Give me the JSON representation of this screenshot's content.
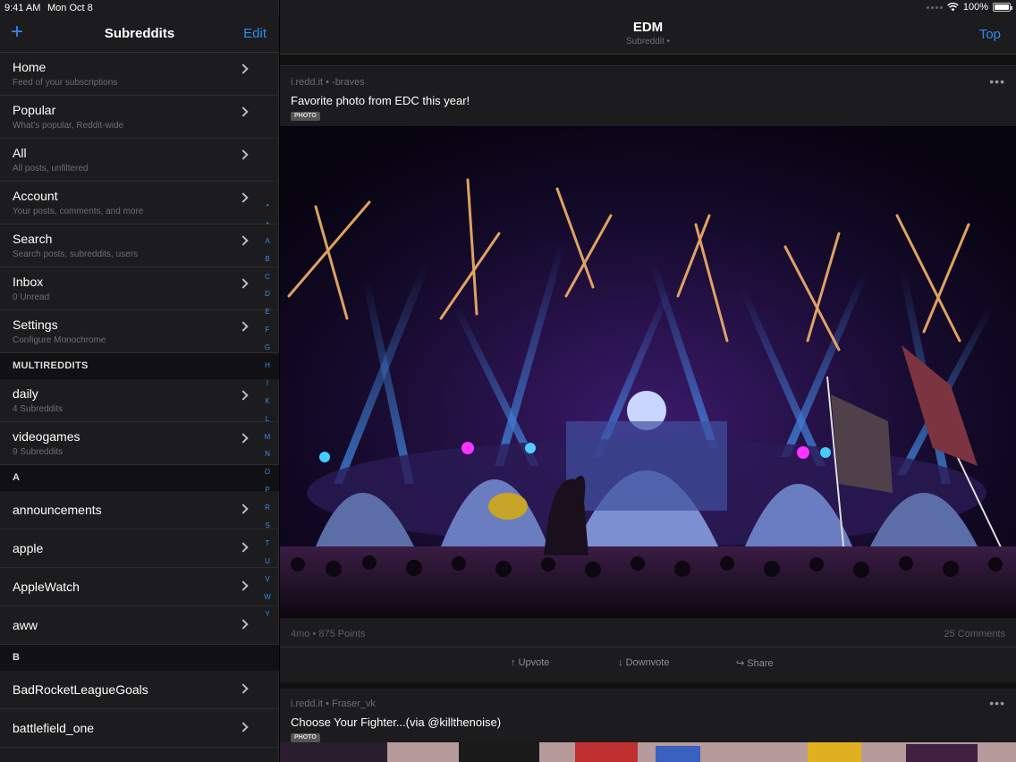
{
  "status": {
    "time": "9:41 AM",
    "date": "Mon Oct 8",
    "battery": "100%"
  },
  "sidebar": {
    "title": "Subreddits",
    "edit_label": "Edit",
    "add_icon": "plus-icon",
    "items": [
      {
        "label": "Home",
        "sub": "Feed of your subscriptions"
      },
      {
        "label": "Popular",
        "sub": "What's popular, Reddit-wide"
      },
      {
        "label": "All",
        "sub": "All posts, unfiltered"
      },
      {
        "label": "Account",
        "sub": "Your posts, comments, and more"
      },
      {
        "label": "Search",
        "sub": "Search posts, subreddits, users"
      },
      {
        "label": "Inbox",
        "sub": "0 Unread"
      },
      {
        "label": "Settings",
        "sub": "Configure Monochrome"
      }
    ],
    "multireddits_header": "MULTIREDDITS",
    "multireddits": [
      {
        "label": "daily",
        "sub": "4 Subreddits"
      },
      {
        "label": "videogames",
        "sub": "9 Subreddits"
      }
    ],
    "section_a": "A",
    "a_items": [
      "announcements",
      "apple",
      "AppleWatch",
      "aww"
    ],
    "section_b": "B",
    "b_items": [
      "BadRocketLeagueGoals",
      "battlefield_one"
    ],
    "index": [
      "•",
      "•",
      "A",
      "B",
      "C",
      "D",
      "E",
      "F",
      "G",
      "H",
      "I",
      "K",
      "L",
      "M",
      "N",
      "O",
      "P",
      "R",
      "S",
      "T",
      "U",
      "V",
      "W",
      "Y"
    ]
  },
  "main": {
    "title": "EDM",
    "subtitle": "Subreddit •",
    "sort_label": "Top",
    "posts": [
      {
        "meta": "i.redd.it • -braves",
        "title": "Favorite photo from EDC this year!",
        "tag": "PHOTO",
        "stats": "4mo • 875 Points",
        "comments": "25 Comments",
        "actions": {
          "upvote": "Upvote",
          "downvote": "Downvote",
          "share": "Share"
        }
      },
      {
        "meta": "i.redd.it • Fraser_vk",
        "title": "Choose Your Fighter...(via @killthenoise)",
        "tag": "PHOTO"
      }
    ]
  },
  "colors": {
    "accent": "#2d8cf0",
    "background": "#1c1c1e"
  }
}
